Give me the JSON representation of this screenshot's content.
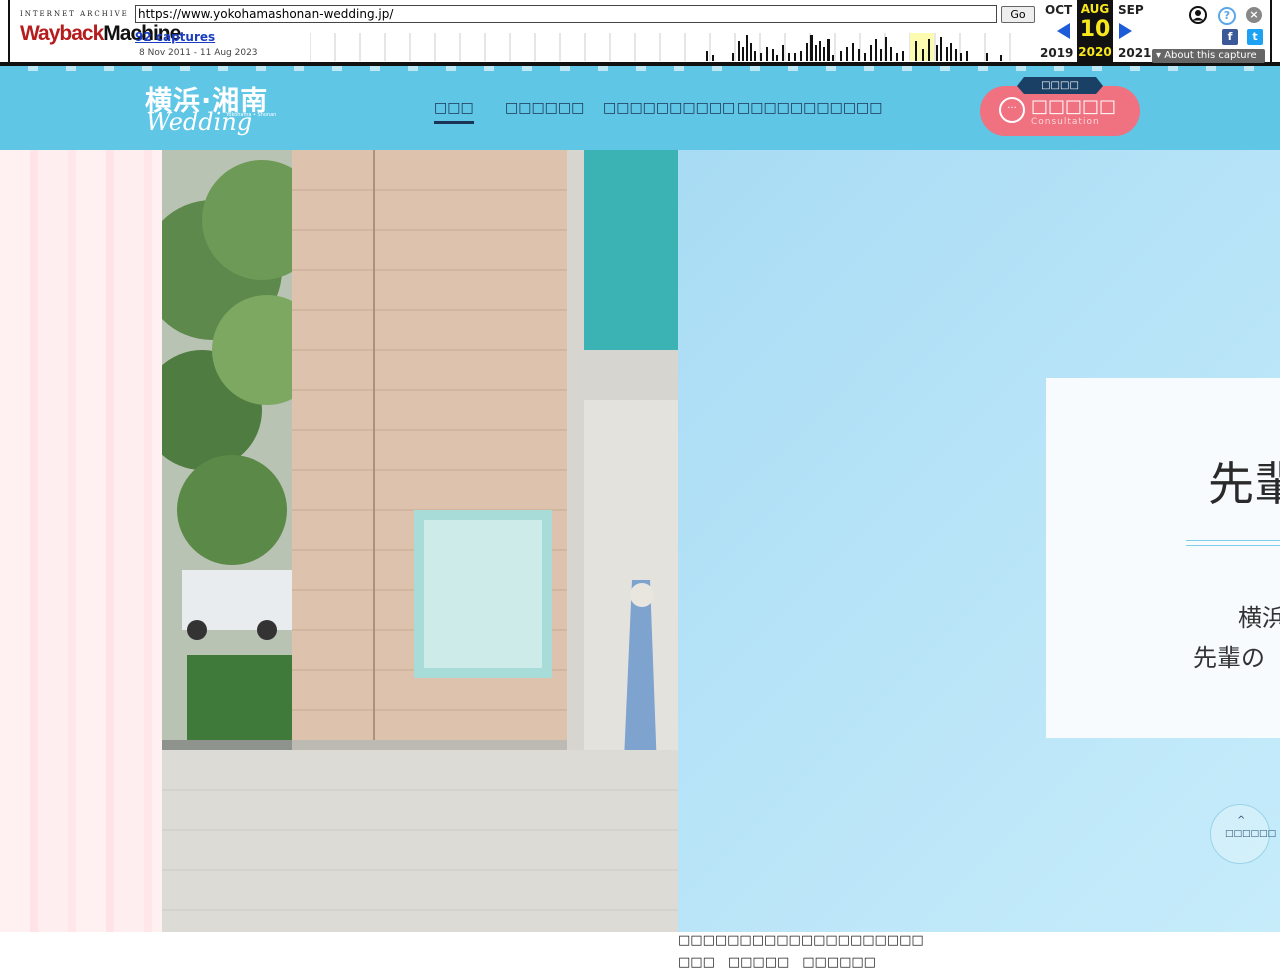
{
  "wayback": {
    "logo_top": "INTERNET ARCHIVE",
    "logo_part1": "Wayback",
    "logo_part2": "Machine",
    "url": "https://www.yokohamashonan-wedding.jp/",
    "go_label": "Go",
    "captures": "92 captures",
    "range": "8 Nov 2011 - 11 Aug 2023",
    "prev_month": "OCT",
    "cur_month": "AUG",
    "next_month": "SEP",
    "cur_day": "10",
    "prev_year": "2019",
    "cur_year": "2020",
    "next_year": "2021",
    "about": "About this capture",
    "help_glyph": "?",
    "close_glyph": "×",
    "facebook_glyph": "f",
    "twitter_glyph": "t"
  },
  "site": {
    "logo_jp": "横浜·湘南",
    "logo_en": "Wedding",
    "logo_sub": "Yokohama • Shonan",
    "nav": [
      "□□□",
      "□□□□□□",
      "□□□□□□□□□□",
      "□□□□□□□□□□□"
    ],
    "cta_tag": "□□□□",
    "cta_label": "□□□□□",
    "cta_sub": "Consultation",
    "cta_icon_glyph": "···"
  },
  "hero": {
    "card_title": "先輩",
    "card_text_1": "横浜",
    "card_text_2": "先輩の",
    "totop_glyph": "^",
    "totop_label": "□□□□□□"
  },
  "footer": {
    "line1": "□□□□□□□□□□□□□□□□□□□□",
    "line2": "□□□　□□□□□　□□□□□□"
  },
  "colors": {
    "header_bg": "#5fc6e6",
    "nav_text": "#1b3456",
    "cta_bg": "#f0717f",
    "hero_right_bg": "#b8e4f8"
  }
}
